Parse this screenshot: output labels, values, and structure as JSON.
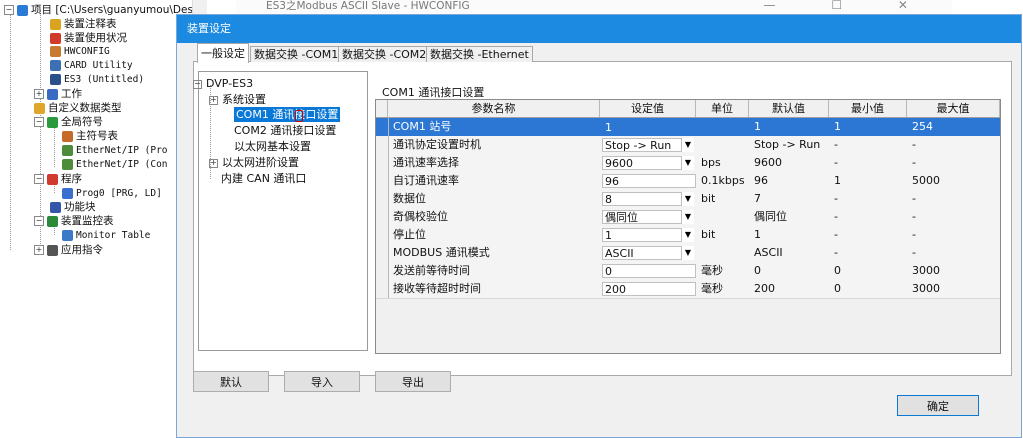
{
  "project_tree": {
    "items": [
      {
        "label": "项目 [C:\\Users\\guanyumou\\Deskt",
        "icon": "project-icon",
        "color": "#2b7bd6"
      },
      {
        "label": "装置注释表",
        "icon": "note-icon",
        "color": "#d9a520"
      },
      {
        "label": "装置使用状况",
        "icon": "status-icon",
        "color": "#d23a2a"
      },
      {
        "label": "HWCONFIG",
        "icon": "hwconfig-icon",
        "color": "#c87a30"
      },
      {
        "label": "CARD Utility",
        "icon": "card-icon",
        "color": "#3d6fb5"
      },
      {
        "label": "ES3  (Untitled)",
        "icon": "plc-icon",
        "color": "#2b4f88"
      },
      {
        "label": "工作",
        "icon": "work-icon",
        "color": "#3a6bc4"
      },
      {
        "label": "自定义数据类型",
        "icon": "datatype-icon",
        "color": "#e0a52b"
      },
      {
        "label": "全局符号",
        "icon": "globe-icon",
        "color": "#2a9b3c"
      },
      {
        "label": "主符号表",
        "icon": "table-icon",
        "color": "#c66a2a"
      },
      {
        "label": "EtherNet/IP (Pro",
        "icon": "ethernet-icon",
        "color": "#4c8c3a"
      },
      {
        "label": "EtherNet/IP (Con",
        "icon": "ethernet-icon",
        "color": "#4c8c3a"
      },
      {
        "label": "程序",
        "icon": "program-icon",
        "color": "#d13b2f"
      },
      {
        "label": "Prog0 [PRG, LD]",
        "icon": "prog-icon",
        "color": "#3a6fd0"
      },
      {
        "label": "功能块",
        "icon": "function-block-icon",
        "color": "#3355aa"
      },
      {
        "label": "装置监控表",
        "icon": "monitor-icon",
        "color": "#2a8a3a"
      },
      {
        "label": "Monitor Table",
        "icon": "monitor-table-icon",
        "color": "#3a7ac8"
      },
      {
        "label": "应用指令",
        "icon": "instruction-icon",
        "color": "#555555"
      }
    ]
  },
  "background_window": {
    "title": "ES3之Modbus ASCII Slave - HWCONFIG",
    "controls": "— ☐ ✕"
  },
  "dialog": {
    "title": "装置设定",
    "tabs": [
      {
        "label": "一般设定"
      },
      {
        "label": "数据交换 -COM1"
      },
      {
        "label": "数据交换 -COM2"
      },
      {
        "label": "数据交换 -Ethernet"
      }
    ],
    "nav_tree": [
      {
        "label": "DVP-ES3",
        "expander": "⊟"
      },
      {
        "label": "系统设置",
        "expander": "⊞"
      },
      {
        "label": "COM1 通讯接口设置",
        "expander": ""
      },
      {
        "label": "COM2 通讯接口设置",
        "expander": ""
      },
      {
        "label": "以太网基本设置",
        "expander": ""
      },
      {
        "label": "以太网进阶设置",
        "expander": "⊞"
      },
      {
        "label": "内建 CAN 通讯口",
        "expander": ""
      }
    ],
    "grid_caption": "COM1 通讯接口设置",
    "grid": {
      "headers": [
        "参数名称",
        "设定值",
        "单位",
        "默认值",
        "最小值",
        "最大值"
      ],
      "rows": [
        {
          "name": "COM1 站号",
          "value": "1",
          "dropdown": false,
          "unit": "",
          "default": "1",
          "min": "1",
          "max": "254"
        },
        {
          "name": "通讯协定设置时机",
          "value": "Stop -> Run",
          "dropdown": true,
          "unit": "",
          "default": "Stop -> Run",
          "min": "-",
          "max": "-"
        },
        {
          "name": "通讯速率选择",
          "value": "9600",
          "dropdown": true,
          "unit": "bps",
          "default": "9600",
          "min": "-",
          "max": "-"
        },
        {
          "name": "自订通讯速率",
          "value": "96",
          "dropdown": false,
          "unit": "0.1kbps",
          "default": "96",
          "min": "1",
          "max": "5000"
        },
        {
          "name": "数据位",
          "value": "8",
          "dropdown": true,
          "unit": "bit",
          "default": "7",
          "min": "-",
          "max": "-"
        },
        {
          "name": "奇偶校验位",
          "value": "偶同位",
          "dropdown": true,
          "unit": "",
          "default": "偶同位",
          "min": "-",
          "max": "-"
        },
        {
          "name": "停止位",
          "value": "1",
          "dropdown": true,
          "unit": "bit",
          "default": "1",
          "min": "-",
          "max": "-"
        },
        {
          "name": "MODBUS 通讯模式",
          "value": "ASCII",
          "dropdown": true,
          "unit": "",
          "default": "ASCII",
          "min": "-",
          "max": "-"
        },
        {
          "name": "发送前等待时间",
          "value": "0",
          "dropdown": false,
          "unit": "毫秒",
          "default": "0",
          "min": "0",
          "max": "3000"
        },
        {
          "name": "接收等待超时时间",
          "value": "200",
          "dropdown": false,
          "unit": "毫秒",
          "default": "200",
          "min": "0",
          "max": "3000"
        }
      ]
    },
    "buttons": {
      "default_label": "默认",
      "import_label": "导入",
      "export_label": "导出",
      "ok_label": "确定"
    },
    "colors": {
      "title_bar": "#1b8ae0",
      "selection": "#2c77d4"
    }
  }
}
